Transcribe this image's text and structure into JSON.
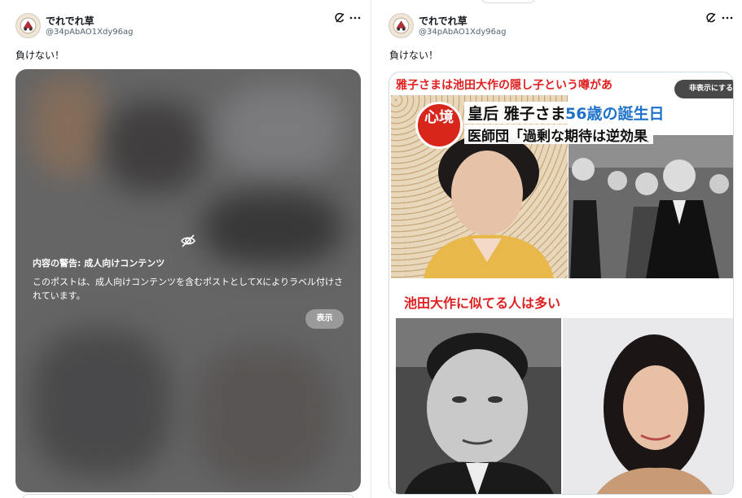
{
  "posts": [
    {
      "user": {
        "display_name": "でれでれ草",
        "handle": "@34pAbAO1Xdy96ag"
      },
      "text": "負けない！",
      "media_warning": {
        "title": "内容の警告: 成人向けコンテンツ",
        "body": "このポストは、成人向けコンテンツを含むポストとしてXによりラベル付けされています。",
        "show_label": "表示"
      }
    },
    {
      "user": {
        "display_name": "でれでれ草",
        "handle": "@34pAbAO1Xdy96ag"
      },
      "text": "負けない！",
      "image": {
        "hide_label": "非表示にする",
        "headline_top": "雅子さまは池田大作の隠し子という噂があ",
        "badge": "心境",
        "caption_line1_black": "皇后 雅子さま",
        "caption_line1_blue": "56歳の誕生日",
        "caption_line2": "医師団「過剰な期待は逆効果」",
        "headline_bottom": "池田大作に似てる人は多い"
      }
    }
  ],
  "icons": [
    "grok-icon",
    "more-icon",
    "eye-off-icon"
  ],
  "colors": {
    "headline_red": "#e02020",
    "caption_blue": "#1f72c9",
    "badge_red": "#d8261b"
  }
}
